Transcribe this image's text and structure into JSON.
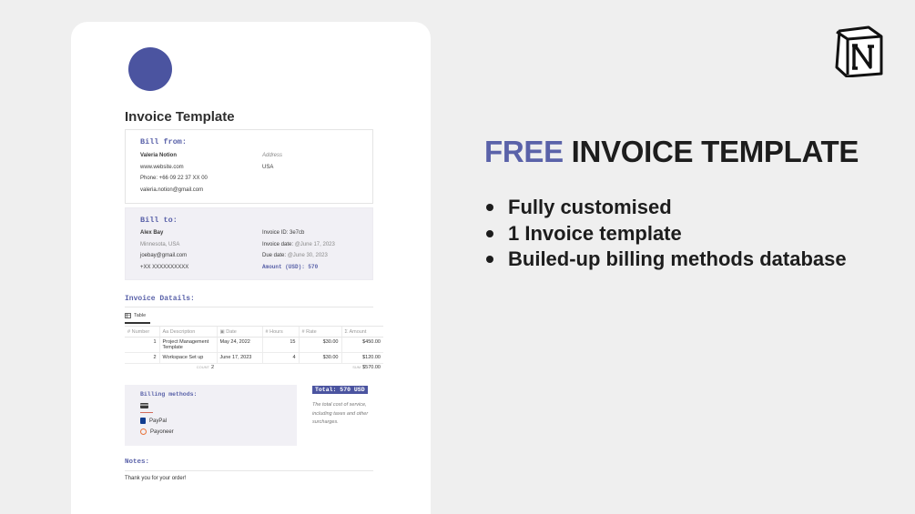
{
  "invoice": {
    "title": "Invoice Template",
    "bill_from": {
      "heading": "Bill from:",
      "name": "Valeria Notion",
      "website": "www.website.com",
      "phone": "Phone: +66 09 22 37 XX 00",
      "email": "valeria.notion@gmail.com",
      "address_label": "Address",
      "address_value": "USA"
    },
    "bill_to": {
      "heading": "Bill to:",
      "name": "Alex Bay",
      "location": "Minnesota, USA",
      "email": "joebay@gmail.com",
      "phone": "+XX XXXXXXXXXX",
      "invoice_id": "Invoice ID: 3e7cb",
      "invoice_date_label": "Invoice date:",
      "invoice_date_value": "@June 17, 2023",
      "due_date_label": "Due date:",
      "due_date_value": "@June 30, 2023",
      "amount": "Amount (USD): 570"
    },
    "details": {
      "heading": "Invoice Datails:",
      "tab_label": "Table",
      "columns": [
        "Number",
        "Description",
        "Date",
        "Hours",
        "Rate",
        "Amount"
      ],
      "rows": [
        {
          "number": "1",
          "description": "Project Management Template",
          "date": "May 24, 2022",
          "hours": "15",
          "rate": "$30.00",
          "amount": "$450.00"
        },
        {
          "number": "2",
          "description": "Workspace Set up",
          "date": "June 17, 2023",
          "hours": "4",
          "rate": "$30.00",
          "amount": "$120.00"
        }
      ],
      "count_label": "COUNT",
      "count_value": "2",
      "sum_label": "SUM",
      "sum_value": "$570.00"
    },
    "billing": {
      "heading": "Billing methods:",
      "methods": [
        "PayPal",
        "Payoneer"
      ]
    },
    "total": {
      "label": "Total: 570 USD",
      "description": "The total cost of service, including taxes and other surcharges."
    },
    "notes": {
      "heading": "Notes:",
      "text": "Thank you for your order!"
    }
  },
  "promo": {
    "headline_accent": "FREE",
    "headline_rest": " INVOICE TEMPLATE",
    "bullets": [
      "Fully customised",
      "1 Invoice template",
      "Builed-up billing methods database"
    ]
  },
  "colors": {
    "accent": "#5a62a9",
    "avatar": "#4b54a0",
    "panel": "#f1f0f5",
    "background": "#efefef"
  },
  "icons": {
    "logo": "notion-logo-icon",
    "table": "table-icon",
    "card": "credit-card-icon"
  }
}
